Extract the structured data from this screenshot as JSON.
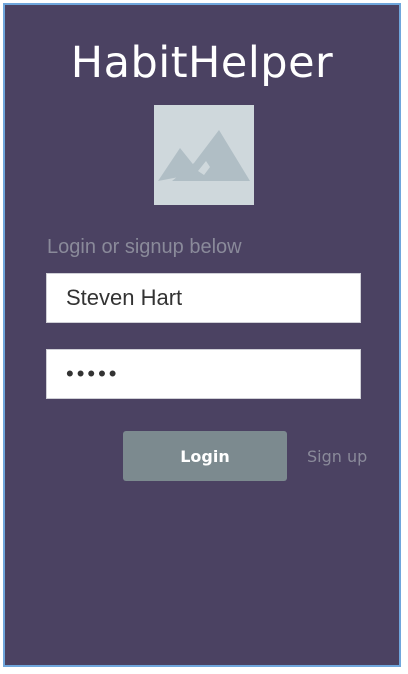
{
  "app": {
    "title": "HabitHelper"
  },
  "logo": {
    "icon": "image-placeholder-icon"
  },
  "form": {
    "instruction": "Login or signup below",
    "username_value": "Steven Hart",
    "password_value": "•••••",
    "login_label": "Login",
    "signup_label": "Sign up"
  },
  "colors": {
    "background": "#4b4262",
    "border": "#6fa6dc",
    "login_button": "#7c8a8f",
    "muted_text": "#8a8a9a",
    "placeholder_bg": "#cfd8dc"
  }
}
